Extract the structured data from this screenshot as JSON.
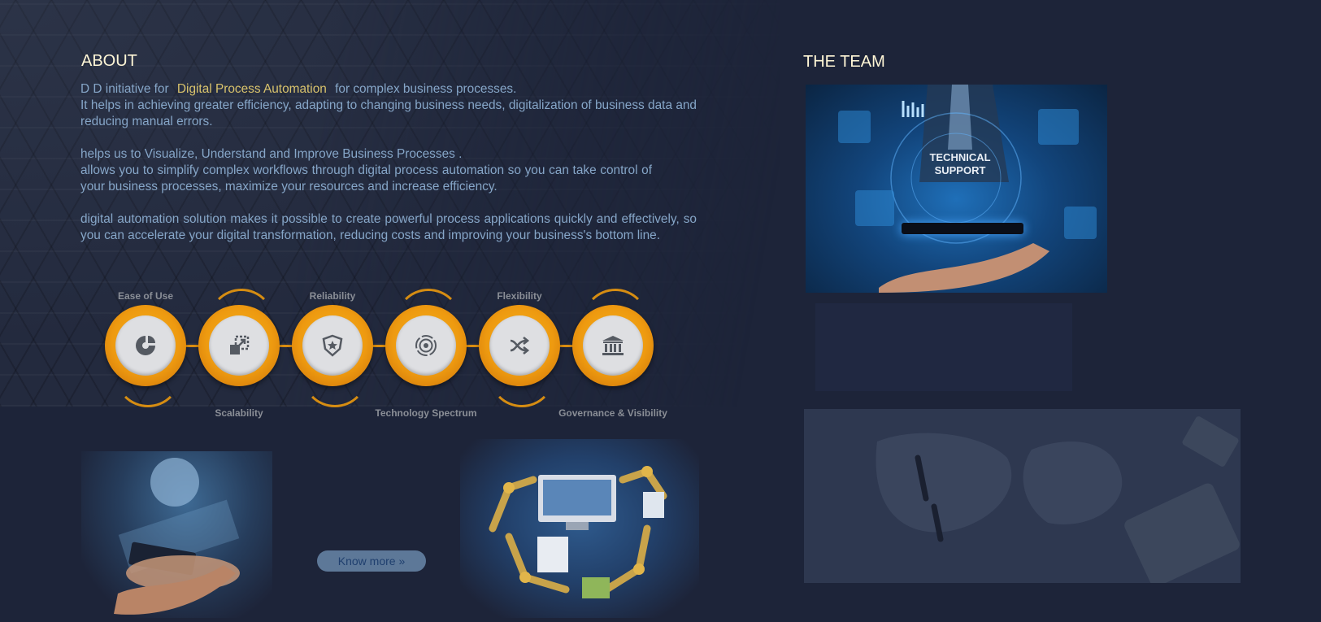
{
  "about": {
    "title": "ABOUT",
    "p1_prefix": "D D initiative for",
    "p1_highlight": "Digital Process Automation",
    "p1_suffix": "for complex business processes.",
    "p1_rest": "It helps in achieving greater efficiency, adapting to changing business needs, digitalization of business data and reducing manual errors.",
    "p2_line1": "helps us to Visualize, Understand and Improve Business Processes .",
    "p2_rest": "allows you to simplify complex workflows through digital process automation so you can take control of your business processes, maximize your resources and increase efficiency.",
    "p3": "digital automation solution makes it possible to create powerful process applications quickly and effectively, so you can accelerate your digital transformation, reducing costs and improving your business's bottom line."
  },
  "features": [
    {
      "label": "Ease of Use",
      "icon": "pie-chart-icon"
    },
    {
      "label": "Scalability",
      "icon": "resize-icon"
    },
    {
      "label": "Reliability",
      "icon": "shield-star-icon"
    },
    {
      "label": "Technology Spectrum",
      "icon": "target-icon"
    },
    {
      "label": "Flexibility",
      "icon": "shuffle-icon"
    },
    {
      "label": "Governance & Visibility",
      "icon": "institution-icon"
    }
  ],
  "know_more": "Know more »",
  "team": {
    "title": "THE TEAM",
    "support_label_1": "TECHNICAL",
    "support_label_2": "SUPPORT"
  },
  "colors": {
    "background": "#1d2439",
    "heading": "#fff6d6",
    "body_text": "#86a6c8",
    "highlight": "#d9c36c",
    "accent_orange": "#ee9a10"
  }
}
